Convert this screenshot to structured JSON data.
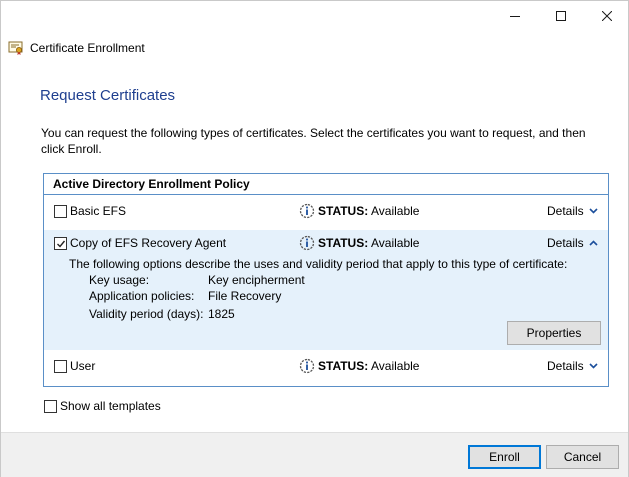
{
  "window": {
    "app_title": "Certificate Enrollment",
    "icons": {
      "app": "certificate-icon",
      "minimize": "minimize-icon",
      "maximize": "maximize-icon",
      "close": "close-icon"
    }
  },
  "page": {
    "title": "Request Certificates",
    "instructions": "You can request the following types of certificates. Select the certificates you want to request, and then click Enroll."
  },
  "policy": {
    "header": "Active Directory Enrollment Policy",
    "items": [
      {
        "label": "Basic EFS",
        "checked": false,
        "status_key": "STATUS:",
        "status_value": "Available",
        "details_label": "Details",
        "expanded": false,
        "status_icon": "info-icon",
        "chevron_icon": "chevron-down-icon"
      },
      {
        "label": "Copy of EFS Recovery Agent",
        "checked": true,
        "status_key": "STATUS:",
        "status_value": "Available",
        "details_label": "Details",
        "expanded": true,
        "status_icon": "info-icon",
        "chevron_icon": "chevron-up-icon",
        "description": "The following options describe the uses and validity period that apply to this type of certificate:",
        "properties": [
          {
            "key": "Key usage:",
            "value": "Key encipherment"
          },
          {
            "key": "Application policies:",
            "value": "File Recovery"
          },
          {
            "key": "Validity period (days):",
            "value": "1825"
          }
        ],
        "properties_button": "Properties"
      },
      {
        "label": "User",
        "checked": false,
        "status_key": "STATUS:",
        "status_value": "Available",
        "details_label": "Details",
        "expanded": false,
        "status_icon": "info-icon",
        "chevron_icon": "chevron-down-icon"
      }
    ]
  },
  "show_all_templates": {
    "label": "Show all templates",
    "checked": false
  },
  "footer": {
    "enroll_label": "Enroll",
    "cancel_label": "Cancel"
  },
  "colors": {
    "title_blue": "#1f3f8f",
    "selection": "#e5f1fb",
    "border_blue": "#5a8fc7",
    "link_chevron": "#1c4f9c",
    "default_button": "#0078d7"
  }
}
